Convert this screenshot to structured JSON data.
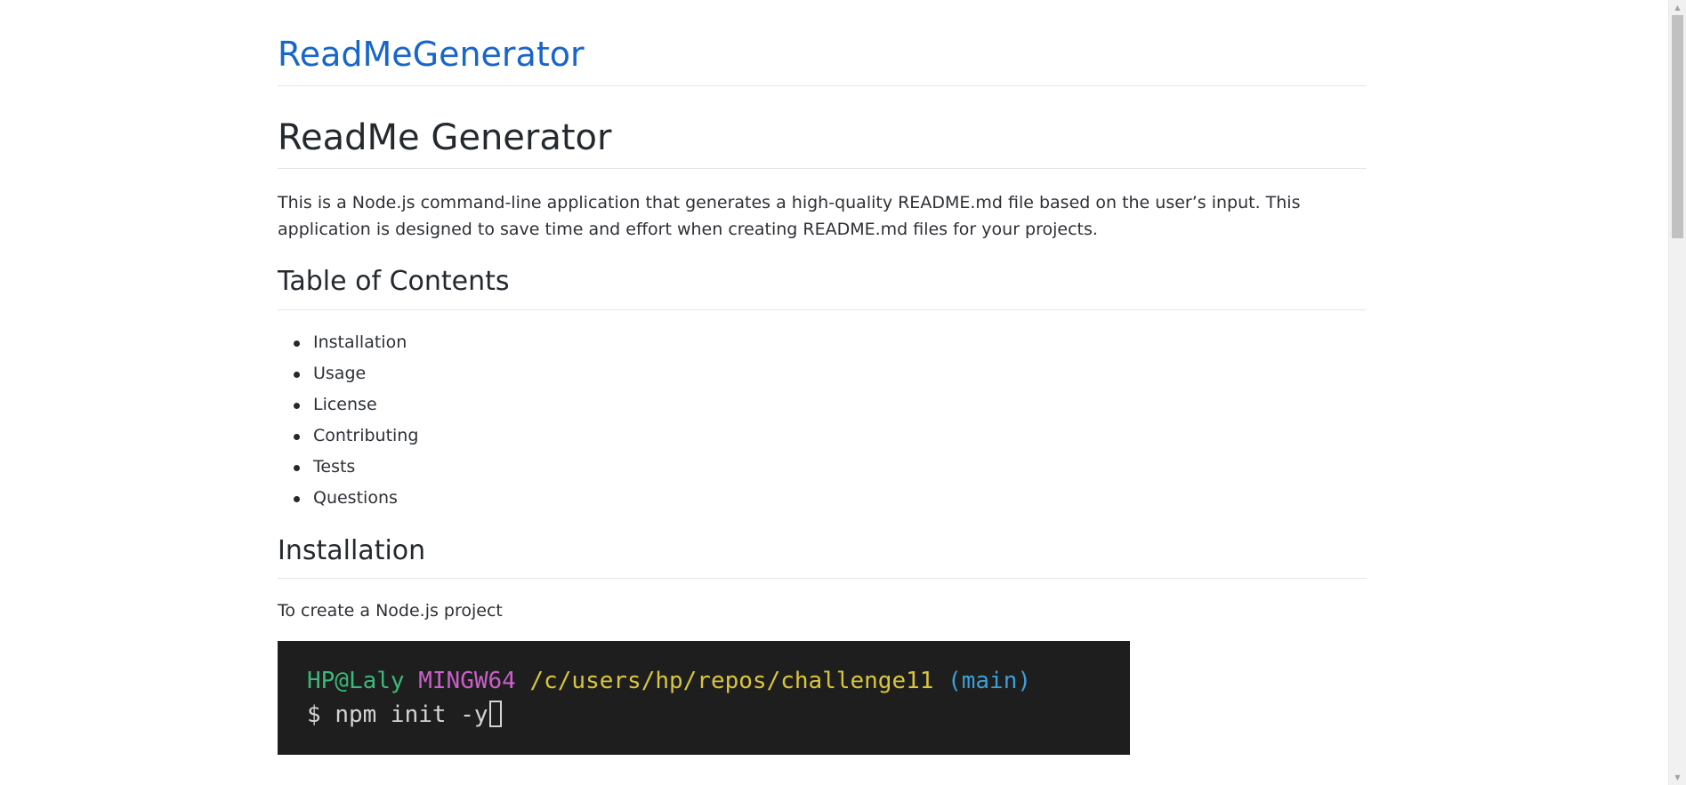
{
  "site": {
    "title": "ReadMeGenerator"
  },
  "article": {
    "title": "ReadMe Generator",
    "intro": "This is a Node.js command-line application that generates a high-quality README.md file based on the user’s input. This application is designed to save time and effort when creating README.md files for your projects.",
    "toc_heading": "Table of Contents",
    "toc_items": [
      "Installation",
      "Usage",
      "License",
      "Contributing",
      "Tests",
      "Questions"
    ],
    "installation": {
      "heading": "Installation",
      "text": "To create a Node.js project",
      "terminal": {
        "user": "HP@Laly",
        "host": "MINGW64",
        "path": "/c/users/hp/repos/challenge11",
        "branch": "(main)",
        "prompt": "$",
        "command": "npm init -y"
      }
    }
  },
  "colors": {
    "link": "#1866c9",
    "terminal_bg": "#1e1e1e",
    "terminal_user": "#3bb97a",
    "terminal_host": "#c95fc9",
    "terminal_path": "#d9c63c",
    "terminal_branch": "#3aa0d8"
  },
  "icons": {
    "scroll_up": "scroll-up-arrow-icon",
    "scroll_down": "scroll-down-arrow-icon"
  }
}
